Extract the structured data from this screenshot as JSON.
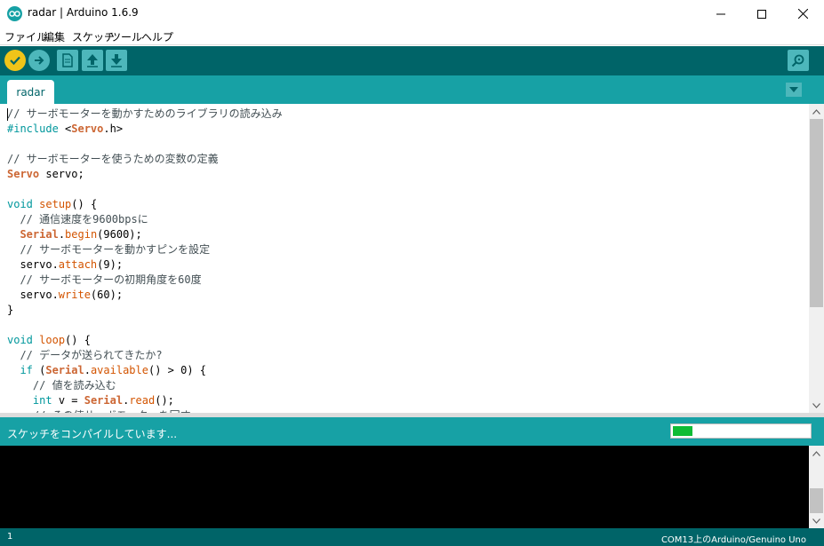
{
  "window": {
    "title": "radar | Arduino 1.6.9",
    "minimize_icon": "minimize-icon",
    "maximize_icon": "maximize-icon",
    "close_icon": "close-icon"
  },
  "menu": {
    "items": [
      "ファイル",
      "編集",
      "スケッチ",
      "ツール",
      "ヘルプ"
    ]
  },
  "toolbar": {
    "verify_icon": "check-icon",
    "upload_icon": "arrow-right-icon",
    "new_icon": "new-file-icon",
    "open_icon": "open-up-arrow-icon",
    "save_icon": "save-down-arrow-icon",
    "serial_icon": "serial-monitor-magnifier-icon"
  },
  "tabs": {
    "active": "radar",
    "menu_icon": "triangle-down-icon"
  },
  "code": {
    "lines": [
      "// サーボモーターを動かすためのライブラリの読み込み",
      "#include <Servo.h>",
      "",
      "// サーボモーターを使うための変数の定義",
      "Servo servo;",
      "",
      "void setup() {",
      "  // 通信速度を9600bpsに",
      "  Serial.begin(9600);",
      "  // サーボモーターを動かすピンを設定",
      "  servo.attach(9);",
      "  // サーボモーターの初期角度を60度",
      "  servo.write(60);",
      "}",
      "",
      "void loop() {",
      "  // データが送られてきたか?",
      "  if (Serial.available() > 0) {",
      "    // 値を読み込む",
      "    int v = Serial.read();",
      "    // その値サーボモーターを回す"
    ]
  },
  "status": {
    "message": "スケッチをコンパイルしています...",
    "progress": 0.14,
    "progress_color": "#0fbc35"
  },
  "footer": {
    "line_number": "1",
    "board": "COM13上のArduino/Genuino Uno"
  },
  "colors": {
    "teal_dark": "#006468",
    "teal": "#17a1a5",
    "teal_light": "#4db7bb",
    "verify_yellow": "#f0c419"
  }
}
